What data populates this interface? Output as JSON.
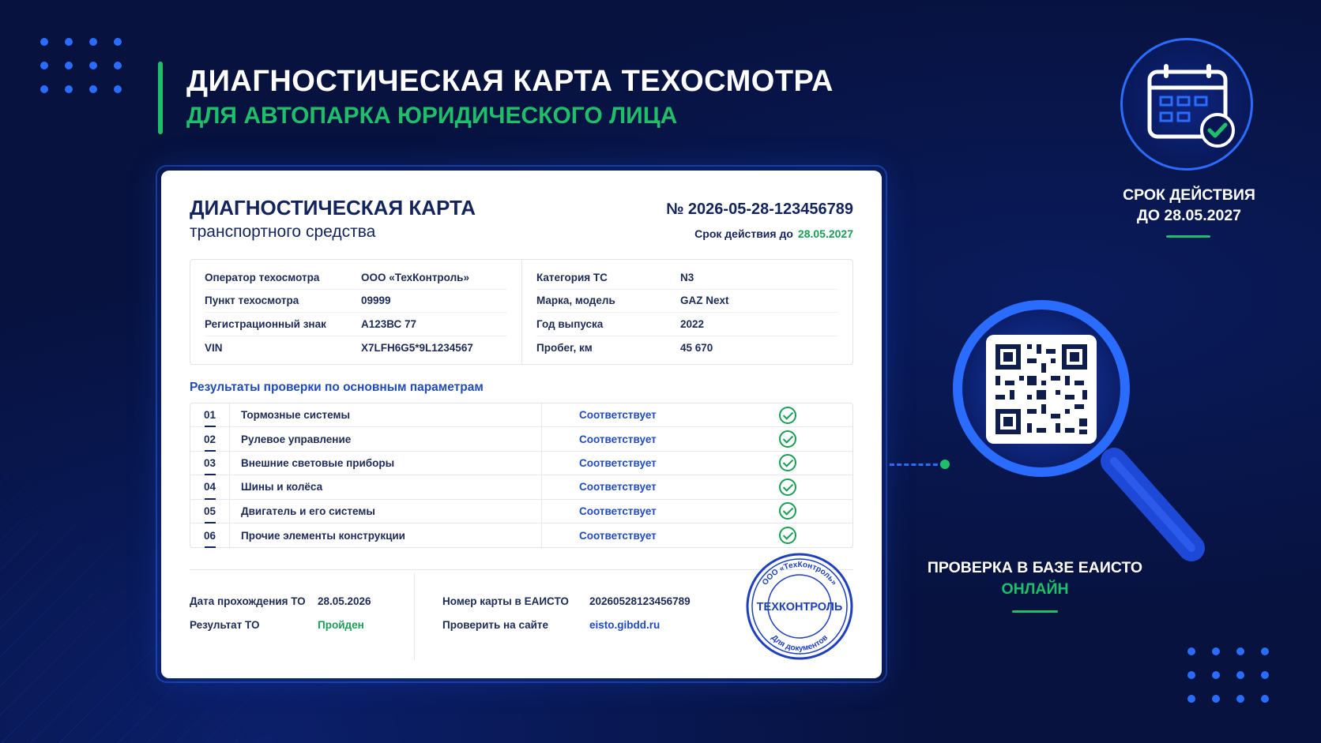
{
  "header": {
    "title": "ДИАГНОСТИЧЕСКАЯ КАРТА ТЕХОСМОТРА",
    "subtitle": "ДЛЯ АВТОПАРКА ЮРИДИЧЕСКОГО ЛИЦА"
  },
  "card": {
    "title": "ДИАГНОСТИЧЕСКАЯ КАРТА",
    "subtitle": "транспортного средства",
    "number": "№ 2026-05-28-123456789",
    "valid_label": "Срок действия до",
    "valid_date": "28.05.2027",
    "info_left": [
      {
        "label": "Оператор техосмотра",
        "value": "ООО «ТехКонтроль»"
      },
      {
        "label": "Пункт техосмотра",
        "value": "09999"
      },
      {
        "label": "Регистрационный знак",
        "value": "А123ВС 77"
      },
      {
        "label": "VIN",
        "value": "X7LFH6G5*9L1234567"
      }
    ],
    "info_right": [
      {
        "label": "Категория ТС",
        "value": "N3"
      },
      {
        "label": "Марка, модель",
        "value": "GAZ Next"
      },
      {
        "label": "Год выпуска",
        "value": "2022"
      },
      {
        "label": "Пробег, км",
        "value": "45 670"
      }
    ],
    "results_heading": "Результаты проверки по основным параметрам",
    "results": [
      {
        "num": "01",
        "name": "Тормозные системы",
        "status": "Соответствует"
      },
      {
        "num": "02",
        "name": "Рулевое управление",
        "status": "Соответствует"
      },
      {
        "num": "03",
        "name": "Внешние световые приборы",
        "status": "Соответствует"
      },
      {
        "num": "04",
        "name": "Шины и колёса",
        "status": "Соответствует"
      },
      {
        "num": "05",
        "name": "Двигатель и его системы",
        "status": "Соответствует"
      },
      {
        "num": "06",
        "name": "Прочие элементы конструкции",
        "status": "Соответствует"
      }
    ],
    "footer": {
      "date_label": "Дата прохождения ТО",
      "date_value": "28.05.2026",
      "result_label": "Результат ТО",
      "result_value": "Пройден",
      "eaisto_label": "Номер карты в ЕАИСТО",
      "eaisto_value": "20260528123456789",
      "site_label": "Проверить на сайте",
      "site_value": "eisto.gibdd.ru"
    },
    "stamp": {
      "center": "ТЕХКОНТРОЛЬ",
      "top_ring": "ООО «ТехКонтроль»",
      "bottom_ring": "Для документов"
    }
  },
  "validity_badge": {
    "line1": "СРОК ДЕЙСТВИЯ",
    "line2": "ДО 28.05.2027"
  },
  "online_check": {
    "line1": "ПРОВЕРКА В БАЗЕ ЕАИСТО",
    "line2": "ОНЛАЙН"
  },
  "colors": {
    "background": "#07123f",
    "accent_green": "#1fbf6a",
    "accent_blue": "#2a6cff",
    "card_text": "#13235c"
  },
  "icons": [
    "calendar-check-icon",
    "magnifier-icon",
    "qr-code-icon",
    "check-circle-icon"
  ]
}
